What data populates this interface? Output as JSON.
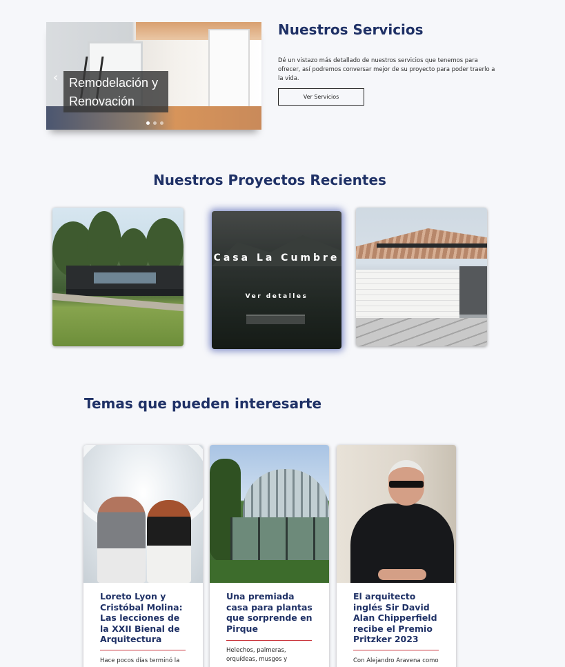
{
  "services": {
    "slide_caption": "Remodelación y Renovación",
    "title": "Nuestros Servicios",
    "description": "Dé un vistazo más detallado de nuestros servicios que tenemos para ofrecer, así podremos conversar mejor de su proyecto para poder traerlo a la vida.",
    "button_label": "Ver Servicios",
    "slider": {
      "total_slides": 3,
      "active_slide": 1
    }
  },
  "projects": {
    "title": "Nuestros Proyectos Recientes",
    "featured": {
      "name": "Casa La Cumbre",
      "details_label": "Ver detalles"
    }
  },
  "topics": {
    "title": "Temas que pueden interesarte",
    "cards": [
      {
        "title": "Loreto Lyon y Cristóbal Molina: Las lecciones de la XXII Bienal de Arquitectura",
        "excerpt": "Hace pocos días terminó la"
      },
      {
        "title": "Una premiada casa para plantas que sorprende en Pirque",
        "excerpt": "Helechos, palmeras, orquídeas, musgos y"
      },
      {
        "title": "El arquitecto inglés Sir David Alan Chipperfield recibe el Premio Pritzker 2023",
        "excerpt": "Con Alejandro Aravena como"
      }
    ]
  },
  "colors": {
    "heading": "#1f3166",
    "accent_rule": "#c9353c",
    "background": "#f6f7fa"
  }
}
